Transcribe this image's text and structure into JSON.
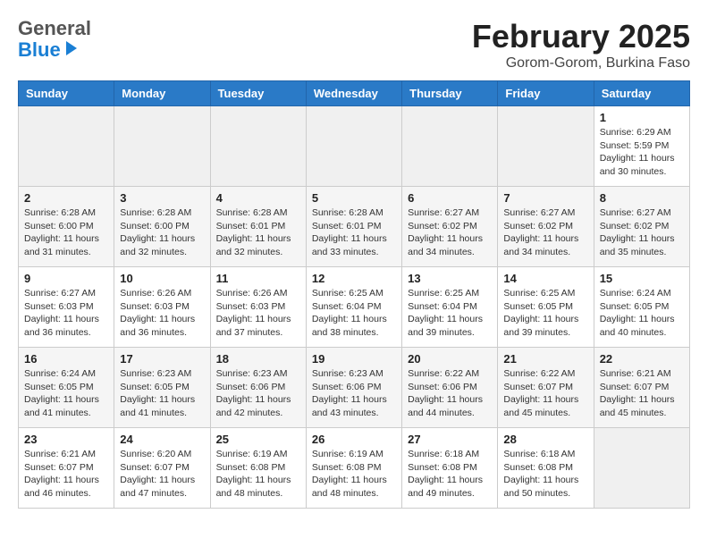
{
  "header": {
    "logo_general": "General",
    "logo_blue": "Blue",
    "title": "February 2025",
    "subtitle": "Gorom-Gorom, Burkina Faso"
  },
  "days_of_week": [
    "Sunday",
    "Monday",
    "Tuesday",
    "Wednesday",
    "Thursday",
    "Friday",
    "Saturday"
  ],
  "weeks": [
    [
      {
        "day": "",
        "info": ""
      },
      {
        "day": "",
        "info": ""
      },
      {
        "day": "",
        "info": ""
      },
      {
        "day": "",
        "info": ""
      },
      {
        "day": "",
        "info": ""
      },
      {
        "day": "",
        "info": ""
      },
      {
        "day": "1",
        "info": "Sunrise: 6:29 AM\nSunset: 5:59 PM\nDaylight: 11 hours and 30 minutes."
      }
    ],
    [
      {
        "day": "2",
        "info": "Sunrise: 6:28 AM\nSunset: 6:00 PM\nDaylight: 11 hours and 31 minutes."
      },
      {
        "day": "3",
        "info": "Sunrise: 6:28 AM\nSunset: 6:00 PM\nDaylight: 11 hours and 32 minutes."
      },
      {
        "day": "4",
        "info": "Sunrise: 6:28 AM\nSunset: 6:01 PM\nDaylight: 11 hours and 32 minutes."
      },
      {
        "day": "5",
        "info": "Sunrise: 6:28 AM\nSunset: 6:01 PM\nDaylight: 11 hours and 33 minutes."
      },
      {
        "day": "6",
        "info": "Sunrise: 6:27 AM\nSunset: 6:02 PM\nDaylight: 11 hours and 34 minutes."
      },
      {
        "day": "7",
        "info": "Sunrise: 6:27 AM\nSunset: 6:02 PM\nDaylight: 11 hours and 34 minutes."
      },
      {
        "day": "8",
        "info": "Sunrise: 6:27 AM\nSunset: 6:02 PM\nDaylight: 11 hours and 35 minutes."
      }
    ],
    [
      {
        "day": "9",
        "info": "Sunrise: 6:27 AM\nSunset: 6:03 PM\nDaylight: 11 hours and 36 minutes."
      },
      {
        "day": "10",
        "info": "Sunrise: 6:26 AM\nSunset: 6:03 PM\nDaylight: 11 hours and 36 minutes."
      },
      {
        "day": "11",
        "info": "Sunrise: 6:26 AM\nSunset: 6:03 PM\nDaylight: 11 hours and 37 minutes."
      },
      {
        "day": "12",
        "info": "Sunrise: 6:25 AM\nSunset: 6:04 PM\nDaylight: 11 hours and 38 minutes."
      },
      {
        "day": "13",
        "info": "Sunrise: 6:25 AM\nSunset: 6:04 PM\nDaylight: 11 hours and 39 minutes."
      },
      {
        "day": "14",
        "info": "Sunrise: 6:25 AM\nSunset: 6:05 PM\nDaylight: 11 hours and 39 minutes."
      },
      {
        "day": "15",
        "info": "Sunrise: 6:24 AM\nSunset: 6:05 PM\nDaylight: 11 hours and 40 minutes."
      }
    ],
    [
      {
        "day": "16",
        "info": "Sunrise: 6:24 AM\nSunset: 6:05 PM\nDaylight: 11 hours and 41 minutes."
      },
      {
        "day": "17",
        "info": "Sunrise: 6:23 AM\nSunset: 6:05 PM\nDaylight: 11 hours and 41 minutes."
      },
      {
        "day": "18",
        "info": "Sunrise: 6:23 AM\nSunset: 6:06 PM\nDaylight: 11 hours and 42 minutes."
      },
      {
        "day": "19",
        "info": "Sunrise: 6:23 AM\nSunset: 6:06 PM\nDaylight: 11 hours and 43 minutes."
      },
      {
        "day": "20",
        "info": "Sunrise: 6:22 AM\nSunset: 6:06 PM\nDaylight: 11 hours and 44 minutes."
      },
      {
        "day": "21",
        "info": "Sunrise: 6:22 AM\nSunset: 6:07 PM\nDaylight: 11 hours and 45 minutes."
      },
      {
        "day": "22",
        "info": "Sunrise: 6:21 AM\nSunset: 6:07 PM\nDaylight: 11 hours and 45 minutes."
      }
    ],
    [
      {
        "day": "23",
        "info": "Sunrise: 6:21 AM\nSunset: 6:07 PM\nDaylight: 11 hours and 46 minutes."
      },
      {
        "day": "24",
        "info": "Sunrise: 6:20 AM\nSunset: 6:07 PM\nDaylight: 11 hours and 47 minutes."
      },
      {
        "day": "25",
        "info": "Sunrise: 6:19 AM\nSunset: 6:08 PM\nDaylight: 11 hours and 48 minutes."
      },
      {
        "day": "26",
        "info": "Sunrise: 6:19 AM\nSunset: 6:08 PM\nDaylight: 11 hours and 48 minutes."
      },
      {
        "day": "27",
        "info": "Sunrise: 6:18 AM\nSunset: 6:08 PM\nDaylight: 11 hours and 49 minutes."
      },
      {
        "day": "28",
        "info": "Sunrise: 6:18 AM\nSunset: 6:08 PM\nDaylight: 11 hours and 50 minutes."
      },
      {
        "day": "",
        "info": ""
      }
    ]
  ]
}
